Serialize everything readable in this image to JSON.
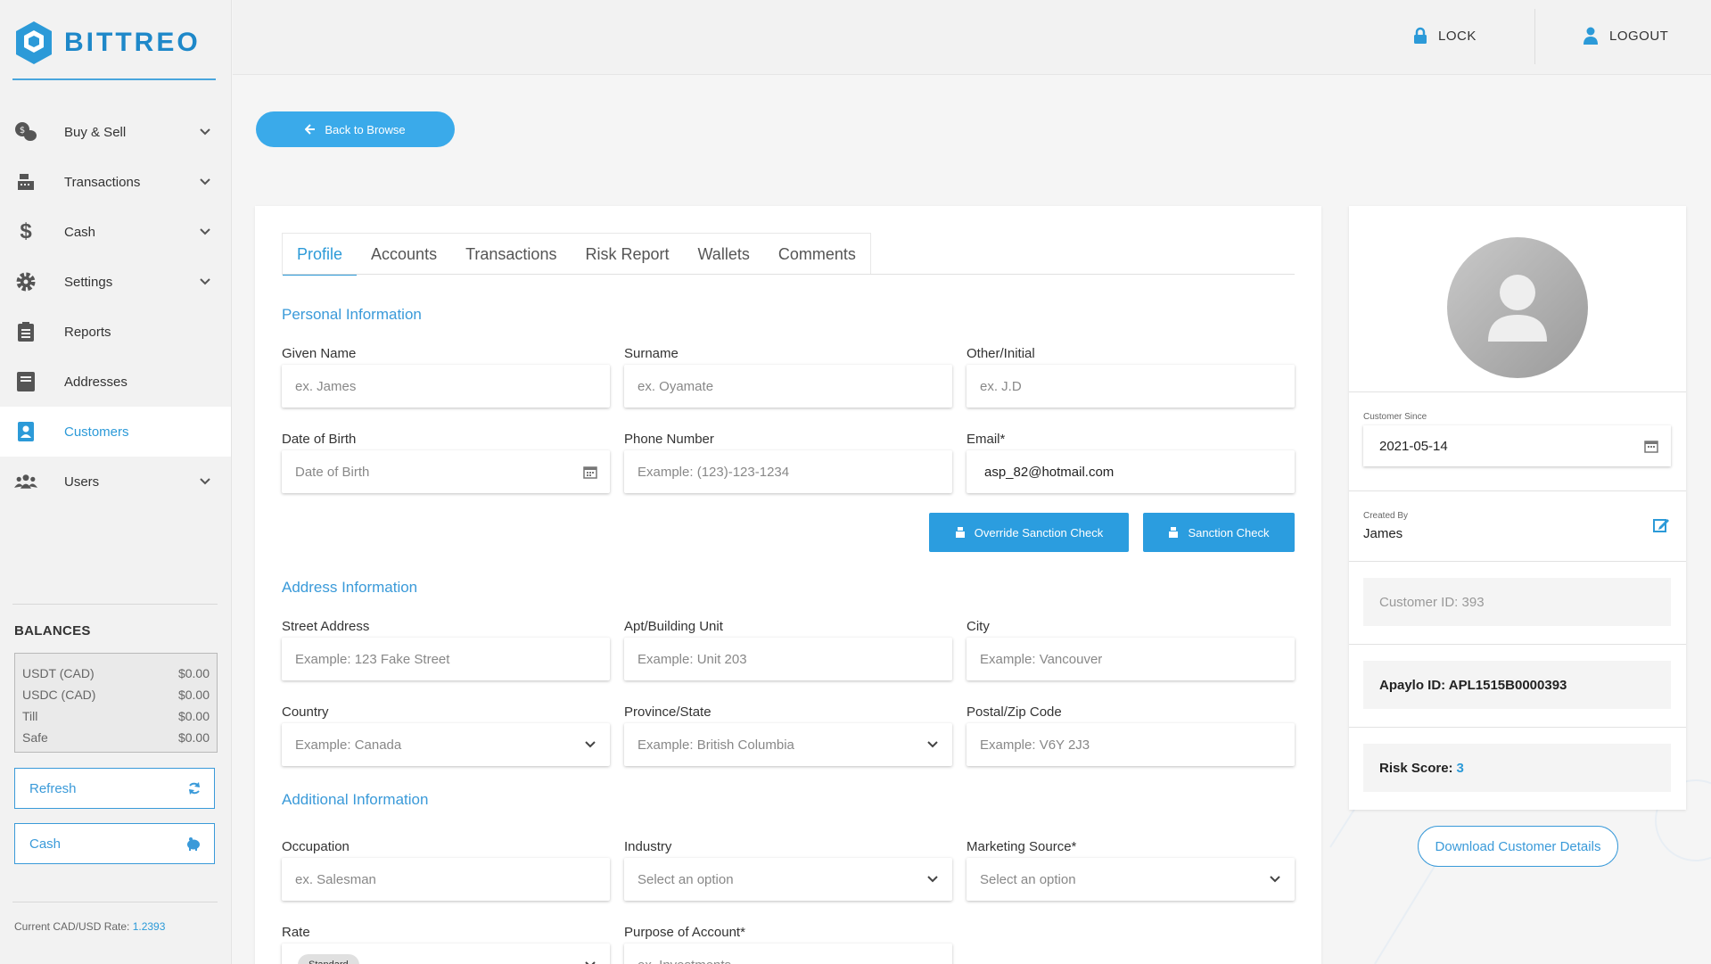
{
  "brand": {
    "name": "BITTREO",
    "color": "#2c9ad8"
  },
  "sidebar": {
    "items": [
      {
        "label": "Buy & Sell",
        "icon": "exchange-icon",
        "has_chevron": true
      },
      {
        "label": "Transactions",
        "icon": "register-icon",
        "has_chevron": true
      },
      {
        "label": "Cash",
        "icon": "dollar-icon",
        "has_chevron": true
      },
      {
        "label": "Settings",
        "icon": "gear-icon",
        "has_chevron": true
      },
      {
        "label": "Reports",
        "icon": "clipboard-icon",
        "has_chevron": false
      },
      {
        "label": "Addresses",
        "icon": "address-book-icon",
        "has_chevron": false
      },
      {
        "label": "Customers",
        "icon": "customer-icon",
        "has_chevron": false,
        "active": true
      },
      {
        "label": "Users",
        "icon": "users-icon",
        "has_chevron": true
      }
    ],
    "balances": {
      "title": "BALANCES",
      "rows": [
        {
          "name": "USDT (CAD)",
          "value": "$0.00"
        },
        {
          "name": "USDC (CAD)",
          "value": "$0.00"
        },
        {
          "name": "Till",
          "value": "$0.00"
        },
        {
          "name": "Safe",
          "value": "$0.00"
        }
      ]
    },
    "refresh_label": "Refresh",
    "cash_label": "Cash",
    "rate_label": "Current CAD/USD Rate: ",
    "rate_value": "1.2393"
  },
  "topbar": {
    "lock_label": "LOCK",
    "logout_label": "LOGOUT"
  },
  "back_label": "Back to Browse",
  "tabs": [
    "Profile",
    "Accounts",
    "Transactions",
    "Risk Report",
    "Wallets",
    "Comments"
  ],
  "personal": {
    "title": "Personal Information",
    "given_name": {
      "label": "Given Name",
      "placeholder": "ex. James"
    },
    "surname": {
      "label": "Surname",
      "placeholder": "ex. Oyamate"
    },
    "other": {
      "label": "Other/Initial",
      "placeholder": "ex. J.D"
    },
    "dob": {
      "label": "Date of Birth",
      "placeholder": "Date of Birth"
    },
    "phone": {
      "label": "Phone Number",
      "placeholder": "Example: (123)-123-1234"
    },
    "email": {
      "label": "Email*",
      "value": "asp_82@hotmail.com"
    },
    "override_label": "Override Sanction Check",
    "sanction_label": "Sanction Check"
  },
  "address": {
    "title": "Address Information",
    "street": {
      "label": "Street Address",
      "placeholder": "Example: 123 Fake Street"
    },
    "apt": {
      "label": "Apt/Building Unit",
      "placeholder": "Example: Unit 203"
    },
    "city": {
      "label": "City",
      "placeholder": "Example: Vancouver"
    },
    "country": {
      "label": "Country",
      "placeholder": "Example: Canada"
    },
    "province": {
      "label": "Province/State",
      "placeholder": "Example: British Columbia"
    },
    "postal": {
      "label": "Postal/Zip Code",
      "placeholder": "Example: V6Y 2J3"
    }
  },
  "additional": {
    "title": "Additional Information",
    "occupation": {
      "label": "Occupation",
      "placeholder": "ex. Salesman"
    },
    "industry": {
      "label": "Industry",
      "placeholder": "Select an option"
    },
    "marketing": {
      "label": "Marketing Source*",
      "placeholder": "Select an option"
    },
    "rate": {
      "label": "Rate",
      "value": "Standard"
    },
    "purpose": {
      "label": "Purpose of Account*",
      "placeholder": "ex. Investments"
    }
  },
  "customer": {
    "since_label": "Customer Since",
    "since_value": "2021-05-14",
    "created_label": "Created By",
    "created_value": "James",
    "customer_id": "Customer ID: 393",
    "apaylo_id": "Apaylo ID: APL1515B0000393",
    "risk_label": "Risk Score: ",
    "risk_value": "3",
    "download_label": "Download Customer Details"
  }
}
